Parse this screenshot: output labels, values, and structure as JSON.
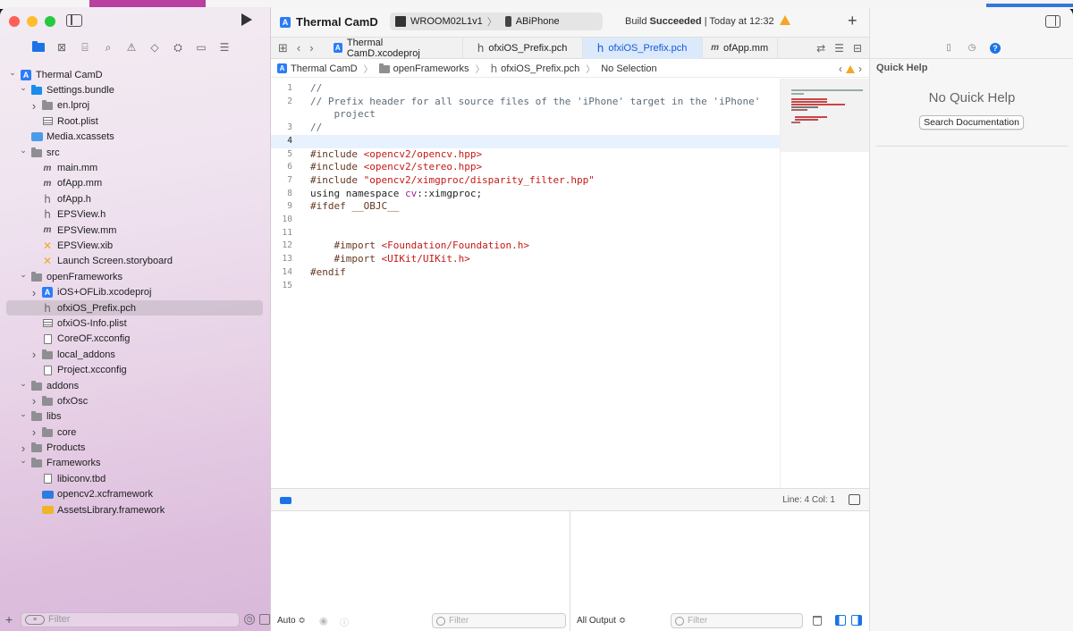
{
  "window": {
    "project_title": "Thermal CamD",
    "scheme": "WROOM02L1v1",
    "device": "ABiPhone",
    "build_status_prefix": "Build",
    "build_status_result": "Succeeded",
    "build_status_time": "| Today at 12:32"
  },
  "tabs": [
    {
      "label": "Thermal CamD.xcodeproj",
      "icon": "xcodeproj-icon"
    },
    {
      "label": "ofxiOS_Prefix.pch",
      "icon": "header-file-icon"
    },
    {
      "label": "ofxiOS_Prefix.pch",
      "icon": "header-file-icon",
      "active": true
    },
    {
      "label": "ofApp.mm",
      "icon": "objc-file-icon"
    }
  ],
  "jumpbar": {
    "project": "Thermal CamD",
    "group": "openFrameworks",
    "file": "ofxiOS_Prefix.pch",
    "selection": "No Selection"
  },
  "navigator": {
    "items": [
      {
        "label": "Thermal CamD",
        "depth": 0,
        "chevron": "open",
        "icon": "proj"
      },
      {
        "label": "Settings.bundle",
        "depth": 1,
        "chevron": "open",
        "icon": "folder-blue"
      },
      {
        "label": "en.lproj",
        "depth": 2,
        "chevron": "closed",
        "icon": "folder"
      },
      {
        "label": "Root.plist",
        "depth": 2,
        "chevron": "",
        "icon": "plist"
      },
      {
        "label": "Media.xcassets",
        "depth": 1,
        "chevron": "",
        "icon": "assets"
      },
      {
        "label": "src",
        "depth": 1,
        "chevron": "open",
        "icon": "folder"
      },
      {
        "label": "main.mm",
        "depth": 2,
        "chevron": "",
        "icon": "m"
      },
      {
        "label": "ofApp.mm",
        "depth": 2,
        "chevron": "",
        "icon": "m"
      },
      {
        "label": "ofApp.h",
        "depth": 2,
        "chevron": "",
        "icon": "h"
      },
      {
        "label": "EPSView.h",
        "depth": 2,
        "chevron": "",
        "icon": "h"
      },
      {
        "label": "EPSView.mm",
        "depth": 2,
        "chevron": "",
        "icon": "m"
      },
      {
        "label": "EPSView.xib",
        "depth": 2,
        "chevron": "",
        "icon": "xib"
      },
      {
        "label": "Launch Screen.storyboard",
        "depth": 2,
        "chevron": "",
        "icon": "xib"
      },
      {
        "label": "openFrameworks",
        "depth": 1,
        "chevron": "open",
        "icon": "folder"
      },
      {
        "label": "iOS+OFLib.xcodeproj",
        "depth": 2,
        "chevron": "closed",
        "icon": "proj"
      },
      {
        "label": "ofxiOS_Prefix.pch",
        "depth": 2,
        "chevron": "",
        "icon": "h",
        "selected": true
      },
      {
        "label": "ofxiOS-Info.plist",
        "depth": 2,
        "chevron": "",
        "icon": "plist"
      },
      {
        "label": "CoreOF.xcconfig",
        "depth": 2,
        "chevron": "",
        "icon": "doc"
      },
      {
        "label": "local_addons",
        "depth": 2,
        "chevron": "closed",
        "icon": "folder"
      },
      {
        "label": "Project.xcconfig",
        "depth": 2,
        "chevron": "",
        "icon": "doc"
      },
      {
        "label": "addons",
        "depth": 1,
        "chevron": "open",
        "icon": "folder"
      },
      {
        "label": "ofxOsc",
        "depth": 2,
        "chevron": "closed",
        "icon": "folder"
      },
      {
        "label": "libs",
        "depth": 1,
        "chevron": "open",
        "icon": "folder"
      },
      {
        "label": "core",
        "depth": 2,
        "chevron": "closed",
        "icon": "folder"
      },
      {
        "label": "Products",
        "depth": 1,
        "chevron": "closed",
        "icon": "folder"
      },
      {
        "label": "Frameworks",
        "depth": 1,
        "chevron": "open",
        "icon": "folder"
      },
      {
        "label": "libiconv.tbd",
        "depth": 2,
        "chevron": "",
        "icon": "doc"
      },
      {
        "label": "opencv2.xcframework",
        "depth": 2,
        "chevron": "",
        "icon": "fw-blue"
      },
      {
        "label": "AssetsLibrary.framework",
        "depth": 2,
        "chevron": "",
        "icon": "fw-yellow"
      }
    ],
    "filter_placeholder": "Filter"
  },
  "editor": {
    "lines": [
      {
        "n": "1",
        "parts": [
          {
            "t": "//",
            "c": "cm"
          }
        ]
      },
      {
        "n": "2",
        "parts": [
          {
            "t": "// Prefix header for all source files of the 'iPhone' target in the 'iPhone'",
            "c": "cm"
          }
        ]
      },
      {
        "n": "",
        "parts": [
          {
            "t": "    project",
            "c": "cm"
          }
        ]
      },
      {
        "n": "3",
        "parts": [
          {
            "t": "//",
            "c": "cm"
          }
        ]
      },
      {
        "n": "4",
        "parts": [],
        "current": true
      },
      {
        "n": "5",
        "parts": [
          {
            "t": "#include ",
            "c": "pp"
          },
          {
            "t": "<opencv2/opencv.hpp>",
            "c": "str"
          }
        ]
      },
      {
        "n": "6",
        "parts": [
          {
            "t": "#include ",
            "c": "pp"
          },
          {
            "t": "<opencv2/stereo.hpp>",
            "c": "str"
          }
        ]
      },
      {
        "n": "7",
        "parts": [
          {
            "t": "#include ",
            "c": "pp"
          },
          {
            "t": "\"opencv2/ximgproc/disparity_filter.hpp\"",
            "c": "str"
          }
        ]
      },
      {
        "n": "8",
        "parts": [
          {
            "t": "using namespace ",
            "c": ""
          },
          {
            "t": "cv",
            "c": "kw"
          },
          {
            "t": "::ximgproc;",
            "c": ""
          }
        ]
      },
      {
        "n": "9",
        "parts": [
          {
            "t": "#ifdef __OBJC__",
            "c": "pp"
          }
        ]
      },
      {
        "n": "10",
        "parts": []
      },
      {
        "n": "11",
        "parts": []
      },
      {
        "n": "12",
        "parts": [
          {
            "t": "    #import ",
            "c": "pp"
          },
          {
            "t": "<Foundation/Foundation.h>",
            "c": "str"
          }
        ]
      },
      {
        "n": "13",
        "parts": [
          {
            "t": "    #import ",
            "c": "pp"
          },
          {
            "t": "<UIKit/UIKit.h>",
            "c": "str"
          }
        ]
      },
      {
        "n": "14",
        "parts": [
          {
            "t": "#endif",
            "c": "pp"
          }
        ]
      },
      {
        "n": "15",
        "parts": []
      }
    ]
  },
  "status": {
    "cursor": "Line: 4  Col: 1"
  },
  "console": {
    "auto_label": "Auto ≎",
    "output_label": "All Output ≎",
    "filter_placeholder": "Filter"
  },
  "inspector": {
    "title": "Quick Help",
    "empty": "No Quick Help",
    "search_button": "Search Documentation"
  },
  "colors": {
    "accent": "#1a73e8",
    "warning": "#f5a623",
    "string": "#c41a16",
    "comment": "#5d6c79",
    "preprocessor": "#643820"
  }
}
